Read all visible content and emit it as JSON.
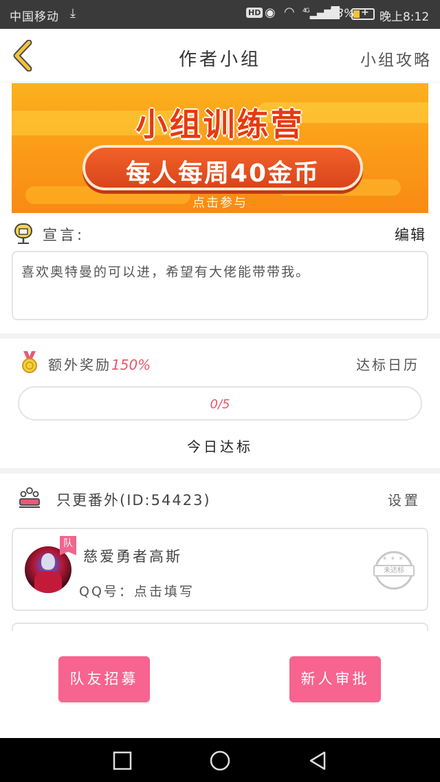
{
  "status_bar": {
    "carrier": "中国移动",
    "download_icon": "download-icon",
    "hd_badge": "HD",
    "network": "4G",
    "battery_percent": "18%",
    "time": "晚上8:12"
  },
  "nav": {
    "back_icon": "chevron-left-icon",
    "title": "作者小组",
    "right_link": "小组攻略"
  },
  "banner": {
    "title": "小组训练营",
    "subtitle": "每人每周40金币",
    "cta": "点击参与"
  },
  "declaration": {
    "icon": "mailbox-icon",
    "label": "宣言:",
    "edit_label": "编辑",
    "text": "喜欢奥特曼的可以进，希望有大佬能带带我。"
  },
  "reward": {
    "icon": "medal-icon",
    "label": "额外奖励",
    "percent": "150%",
    "calendar_link": "达标日历",
    "progress_text": "0/5",
    "progress_fraction": 0,
    "today_label": "今日达标"
  },
  "group": {
    "icon": "group-icon",
    "name": "只更番外(ID:54423)",
    "settings_label": "设置",
    "members": [
      {
        "badge": "队",
        "name": "慈爱勇者高斯",
        "qq": "QQ号：点击填写",
        "stamp": "未达标"
      }
    ]
  },
  "buttons": {
    "recruit": "队友招募",
    "approve": "新人审批"
  },
  "colors": {
    "accent_pink": "#f6648f",
    "reward_red": "#e8566c",
    "banner_orange": "#fb9a17",
    "back_yellow": "#f4c23c"
  }
}
